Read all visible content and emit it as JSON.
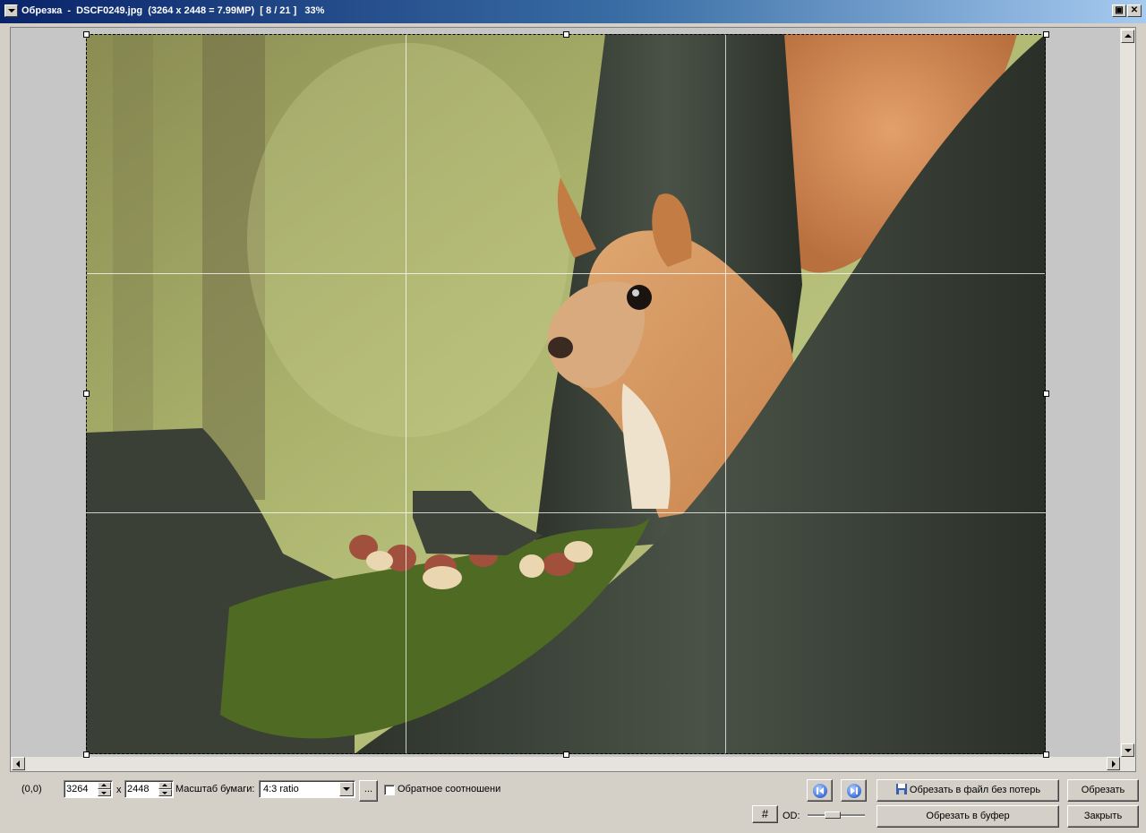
{
  "window": {
    "title": "Обрезка  -  DSCF0249.jpg  (3264 x 2448 = 7.99MP)  [ 8 / 21 ]   33%",
    "restore_label": "▣",
    "close_label": "✕"
  },
  "toolbar": {
    "coords": "(0,0)",
    "width_value": "3264",
    "times_label": "x",
    "height_value": "2448",
    "paper_scale_label": "Масштаб бумаги:",
    "ratio_selected": "4:3 ratio",
    "ratio_more_label": "...",
    "inverse_ratio_label": "Обратное соотношени",
    "inverse_ratio_checked": false,
    "grid_button_label": "#",
    "od_label": "OD:",
    "save_lossless_label": "Обрезать в файл без потерь",
    "crop_label": "Обрезать",
    "crop_to_clipboard_label": "Обрезать в буфер",
    "close_label": "Закрыть"
  },
  "colors": {
    "titlebar_start": "#0a246a",
    "titlebar_end": "#a6caf0",
    "chrome": "#d4d0c8"
  }
}
